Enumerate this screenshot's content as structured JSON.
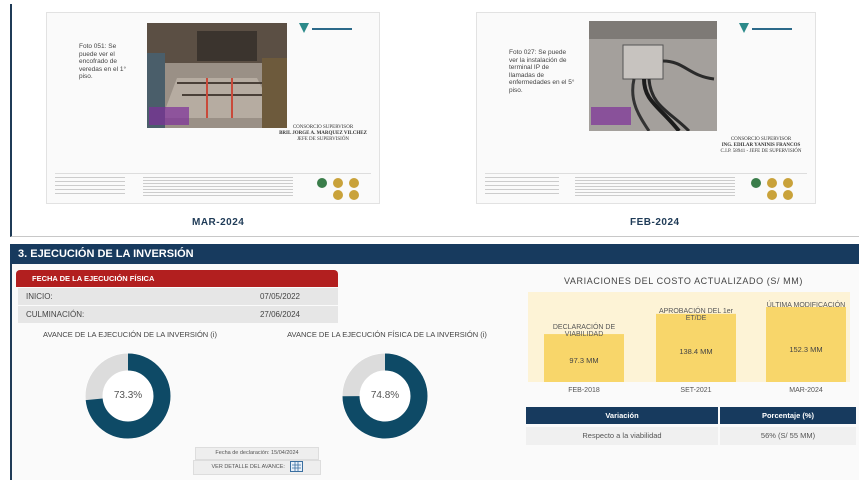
{
  "photos": [
    {
      "caption": "Foto 051: Se puede ver el encofrado de veredas en el 1° piso.",
      "signature_line1": "CONSORCIO SUPERVISOR",
      "signature_line2": "BRIL JORGE A. MARQUEZ VILCHEZ",
      "signature_line3": "JEFE DE SUPERVISIÓN",
      "month": "MAR-2024"
    },
    {
      "caption": "Foto 027: Se puede ver la instalación de terminal IP de llamadas de enfermedades en el 5° piso.",
      "signature_line1": "CONSORCIO SUPERVISOR",
      "signature_line2": "ING. EDILAR YANINIS FRANCOS",
      "signature_line3": "C.I.P. 58941 - JEFE DE SUPERVISIÓN",
      "month": "FEB-2024"
    }
  ],
  "section": {
    "title": "3. EJECUCIÓN DE LA INVERSIÓN"
  },
  "physical": {
    "header": "FECHA DE LA EJECUCIÓN FÍSICA",
    "rows": [
      {
        "label": "INICIO:",
        "value": "07/05/2022"
      },
      {
        "label": "CULMINACIÓN:",
        "value": "27/06/2024"
      }
    ]
  },
  "gauges": [
    {
      "title": "AVANCE DE LA EJECUCIÓN DE LA INVERSIÓN (i)",
      "value_label": "73.3%",
      "value": 73.3,
      "color": "#0e4a66",
      "track": "#dcdcdc"
    },
    {
      "title": "AVANCE DE LA EJECUCIÓN FÍSICA DE LA INVERSIÓN (i)",
      "value_label": "74.8%",
      "value": 74.8,
      "color": "#0e4a66",
      "track": "#dcdcdc"
    }
  ],
  "declaration": "Fecha de declaración: 15/04/2024",
  "detail_button": "VER DETALLE DEL AVANCE:",
  "detail_icon": "spreadsheet-icon",
  "chart_data": {
    "type": "bar",
    "title": "VARIACIONES DEL COSTO ACTUALIZADO (S/ MM)",
    "categories": [
      "FEB-2018",
      "SET-2021",
      "MAR-2024"
    ],
    "series_labels": [
      "DECLARACIÓN DE VIABILIDAD",
      "APROBACIÓN DEL 1er ET/DE",
      "ÚLTIMA MODIFICACIÓN"
    ],
    "values": [
      97.3,
      138.4,
      152.3
    ],
    "value_labels": [
      "97.3 MM",
      "138.4 MM",
      "152.3 MM"
    ],
    "ylim": [
      0,
      152.3
    ],
    "bar_color": "#f8d66a",
    "background_color": "#fdf3d6"
  },
  "variation_table": {
    "headers": [
      "Variación",
      "Porcentaje (%)"
    ],
    "row": [
      "Respecto a la viabilidad",
      "56% (S/ 55 MM)"
    ]
  }
}
